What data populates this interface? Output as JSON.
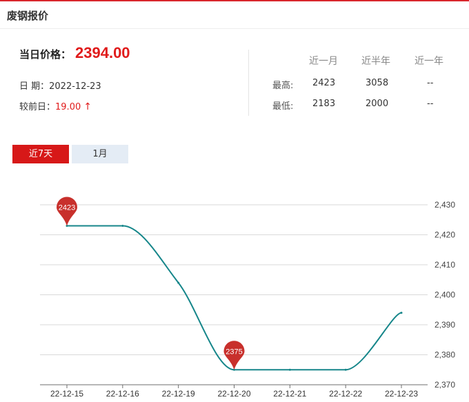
{
  "header": {
    "title": "废钢报价"
  },
  "price": {
    "label": "当日价格：",
    "value": "2394.00"
  },
  "date": {
    "label": "日 期：",
    "value": "2022-12-23"
  },
  "change": {
    "label": "较前日：",
    "value": "19.00",
    "arrow": "↑"
  },
  "stats": {
    "columns": [
      "近一月",
      "近半年",
      "近一年"
    ],
    "rows": [
      {
        "label": "最高:",
        "values": [
          "2423",
          "3058",
          "--"
        ]
      },
      {
        "label": "最低:",
        "values": [
          "2183",
          "2000",
          "--"
        ]
      }
    ]
  },
  "tabs": [
    {
      "label": "近7天",
      "active": true
    },
    {
      "label": "1月",
      "active": false
    }
  ],
  "colors": {
    "accent": "#d71818",
    "line": "#16868a",
    "marker": "#c8302c",
    "price": "#e01b1b"
  },
  "icons": {
    "change_arrow": "arrow-up-icon"
  },
  "chart_data": {
    "type": "line",
    "categories": [
      "22-12-15",
      "22-12-16",
      "22-12-19",
      "22-12-20",
      "22-12-21",
      "22-12-22",
      "22-12-23"
    ],
    "series": [
      {
        "values": [
          2423,
          2423,
          2404,
          2375,
          2375,
          2375,
          2394
        ]
      }
    ],
    "ylim": [
      2370,
      2430
    ],
    "yticks": [
      2370,
      2380,
      2390,
      2400,
      2410,
      2420,
      2430
    ],
    "ytick_labels": [
      "2,370",
      "2,380",
      "2,390",
      "2,400",
      "2,410",
      "2,420",
      "2,430"
    ],
    "markers": [
      {
        "index": 0,
        "label": "2423"
      },
      {
        "index": 3,
        "label": "2375"
      }
    ],
    "grid": true,
    "yaxis_side": "right"
  }
}
